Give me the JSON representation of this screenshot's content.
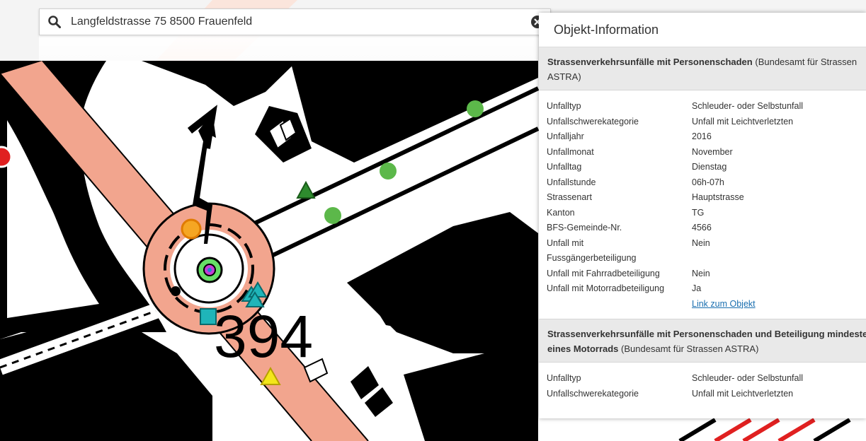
{
  "search": {
    "value": "Langfeldstrasse 75 8500 Frauenfeld",
    "icon": "search-icon",
    "clear_icon": "close-circle-icon"
  },
  "map": {
    "label": "394",
    "colors": {
      "road_fill": "#f2a58e",
      "background": "#ffffff",
      "block": "#000000",
      "tree": "#5cb84a",
      "accident_cyan": "#1fb5b9",
      "accident_yellow": "#f3e61a",
      "accident_orange": "#f5a623"
    }
  },
  "panel": {
    "title": "Objekt-Information",
    "sections": [
      {
        "title": "Strassenverkehrsunfälle mit Personenschaden",
        "source": "(Bundesamt für Strassen ASTRA)",
        "rows": [
          {
            "key": "Unfalltyp",
            "value": "Schleuder- oder Selbstunfall"
          },
          {
            "key": "Unfallschwerekategorie",
            "value": "Unfall mit Leichtverletzten"
          },
          {
            "key": "Unfalljahr",
            "value": "2016"
          },
          {
            "key": "Unfallmonat",
            "value": "November"
          },
          {
            "key": "Unfalltag",
            "value": "Dienstag"
          },
          {
            "key": "Unfallstunde",
            "value": "06h-07h"
          },
          {
            "key": "Strassenart",
            "value": "Hauptstrasse"
          },
          {
            "key": "Kanton",
            "value": "TG"
          },
          {
            "key": "BFS-Gemeinde-Nr.",
            "value": "4566"
          },
          {
            "key": "Unfall mit Fussgängerbeteiligung",
            "value": "Nein"
          },
          {
            "key": "Unfall mit Fahrradbeteiligung",
            "value": "Nein"
          },
          {
            "key": "Unfall mit Motorradbeteiligung",
            "value": "Ja"
          }
        ],
        "link": "Link zum Objekt"
      },
      {
        "title": "Strassenverkehrsunfälle mit Personenschaden und Beteiligung mindestens eines Motorrads",
        "source": "(Bundesamt für Strassen ASTRA)",
        "rows": [
          {
            "key": "Unfalltyp",
            "value": "Schleuder- oder Selbstunfall"
          },
          {
            "key": "Unfallschwerekategorie",
            "value": "Unfall mit Leichtverletzten"
          }
        ]
      }
    ]
  }
}
